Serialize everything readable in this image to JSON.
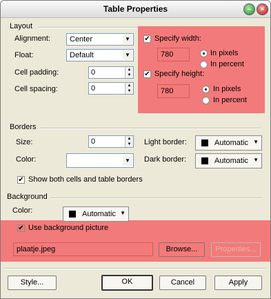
{
  "window": {
    "title": "Table Properties"
  },
  "layout": {
    "section_label": "Layout",
    "alignment": {
      "label": "Alignment:",
      "value": "Center"
    },
    "float": {
      "label": "Float:",
      "value": "Default"
    },
    "cell_padding": {
      "label": "Cell padding:",
      "value": "0"
    },
    "cell_spacing": {
      "label": "Cell spacing:",
      "value": "0"
    },
    "specify_width": {
      "label": "Specify width:",
      "value": "780",
      "checked": true,
      "unit_pixels": "In pixels",
      "unit_percent": "In percent",
      "selected": "pixels"
    },
    "specify_height": {
      "label": "Specify height:",
      "value": "780",
      "checked": true,
      "unit_pixels": "In pixels",
      "unit_percent": "In percent",
      "selected": "pixels"
    }
  },
  "borders": {
    "section_label": "Borders",
    "size": {
      "label": "Size:",
      "value": "0"
    },
    "color": {
      "label": "Color:",
      "value": ""
    },
    "light_border": {
      "label": "Light border:",
      "value": "Automatic"
    },
    "dark_border": {
      "label": "Dark border:",
      "value": "Automatic"
    },
    "show_both": {
      "label": "Show both cells and table borders",
      "checked": true
    }
  },
  "background": {
    "section_label": "Background",
    "color": {
      "label": "Color:",
      "value": "Automatic"
    },
    "use_picture": {
      "label": "Use background picture",
      "checked": true
    },
    "picture_file": "plaatje.jpeg",
    "browse_label": "Browse...",
    "properties_label": "Properties..."
  },
  "buttons": {
    "style": "Style...",
    "ok": "OK",
    "cancel": "Cancel",
    "apply": "Apply"
  },
  "colors": {
    "highlight": "#f37a7a"
  },
  "icons": {
    "check": "✔",
    "arrow": "▼",
    "up": "▲",
    "down": "▼"
  }
}
